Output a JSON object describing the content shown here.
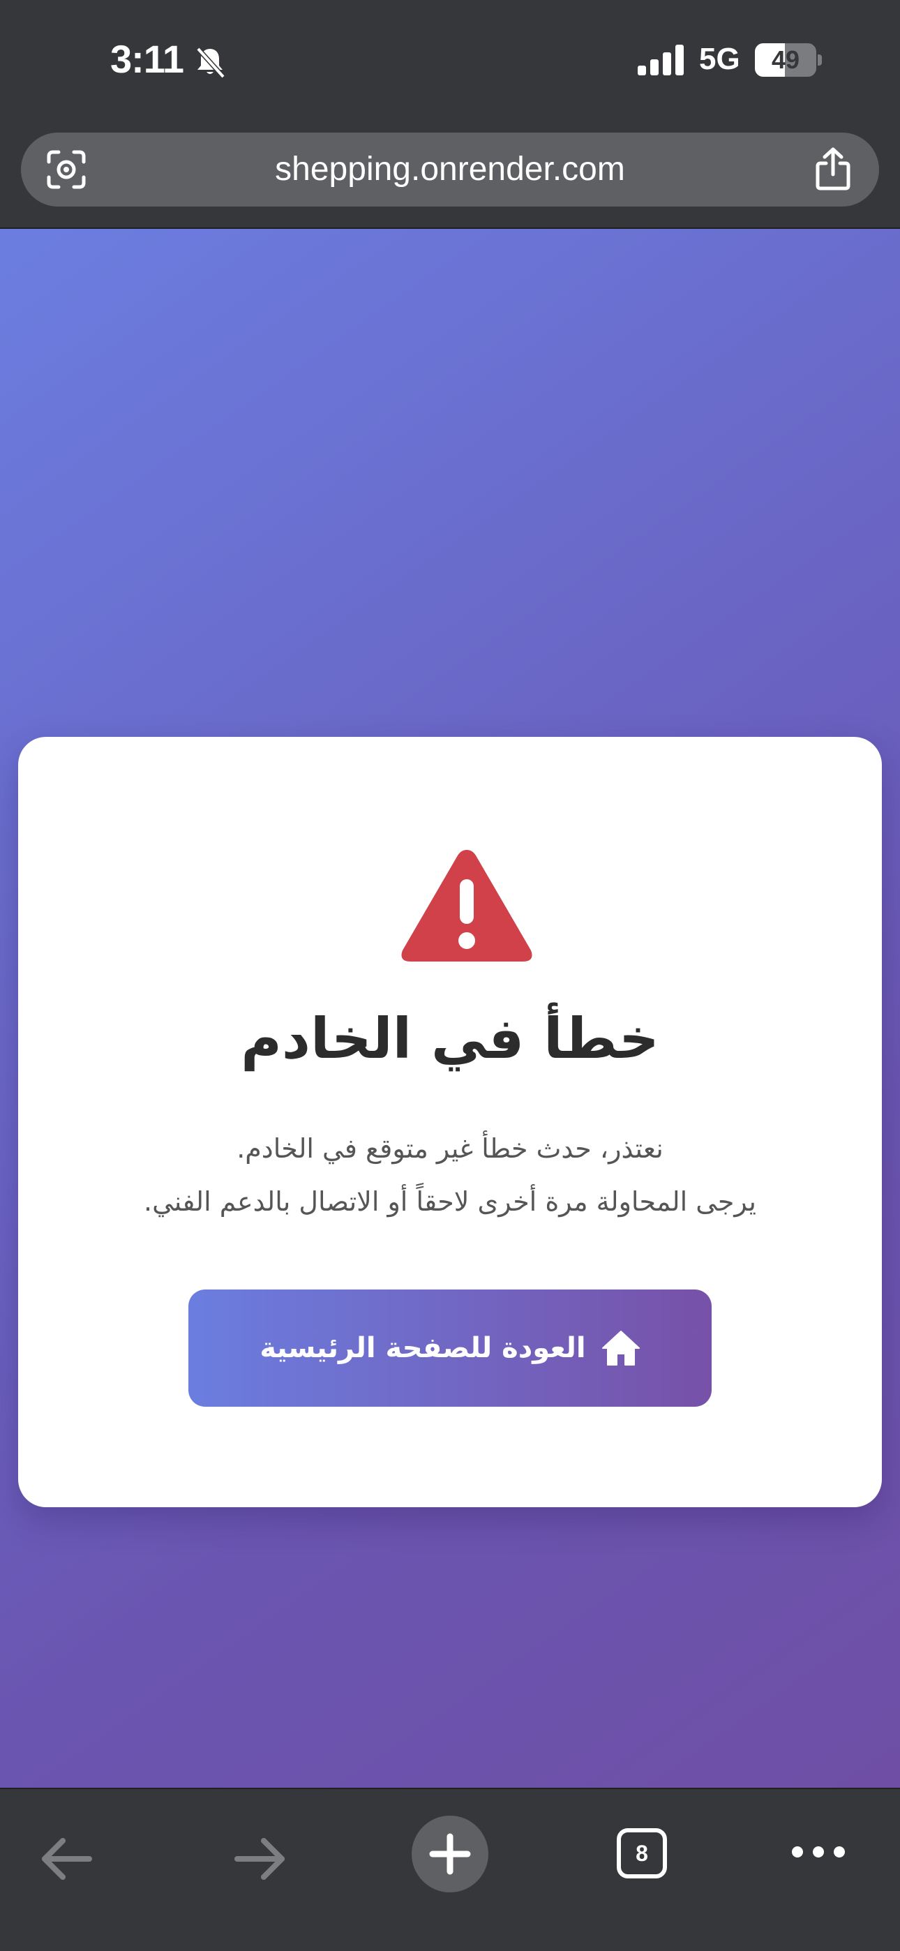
{
  "status_bar": {
    "time": "3:11",
    "network": "5G",
    "battery_level": "49",
    "battery_fraction": 0.49
  },
  "browser": {
    "url": "shepping.onrender.com",
    "tab_count": "8"
  },
  "error_page": {
    "title": "خطأ في الخادم",
    "message_line1": "نعتذر، حدث خطأ غير متوقع في الخادم.",
    "message_line2": "يرجى المحاولة مرة أخرى لاحقاً أو الاتصال بالدعم الفني.",
    "home_button_label": "العودة للصفحة الرئيسية"
  },
  "colors": {
    "warning": "#d0414a",
    "gradient_start": "#6b7ee0",
    "gradient_end": "#7751a8",
    "chrome_bg": "#36373a"
  },
  "icons": [
    "bell-slash-icon",
    "signal-icon",
    "lens-icon",
    "share-icon",
    "warning-icon",
    "home-icon",
    "back-arrow-icon",
    "forward-arrow-icon",
    "plus-icon",
    "more-icon"
  ]
}
